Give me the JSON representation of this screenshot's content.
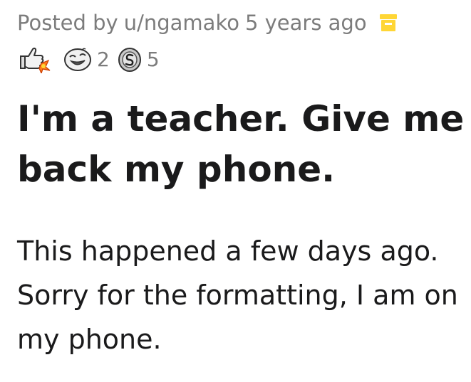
{
  "post": {
    "posted_by_prefix": "Posted by",
    "username": "u/ngamako",
    "timestamp": "5 years ago",
    "archived_icon": "archive-box-icon",
    "awards": [
      {
        "icon": "thumbs-up-rocket-award-icon",
        "count": ""
      },
      {
        "icon": "laughing-face-award-icon",
        "count": "2"
      },
      {
        "icon": "silver-coin-award-icon",
        "count": "5"
      }
    ],
    "title": "I'm a teacher. Give me back my phone.",
    "body": "This happened a few days ago. Sorry for the formatting, I am on my phone."
  },
  "colors": {
    "meta_text": "#7c7c7c",
    "archive_icon": "#ffd635",
    "title_text": "#1a1a1b"
  }
}
